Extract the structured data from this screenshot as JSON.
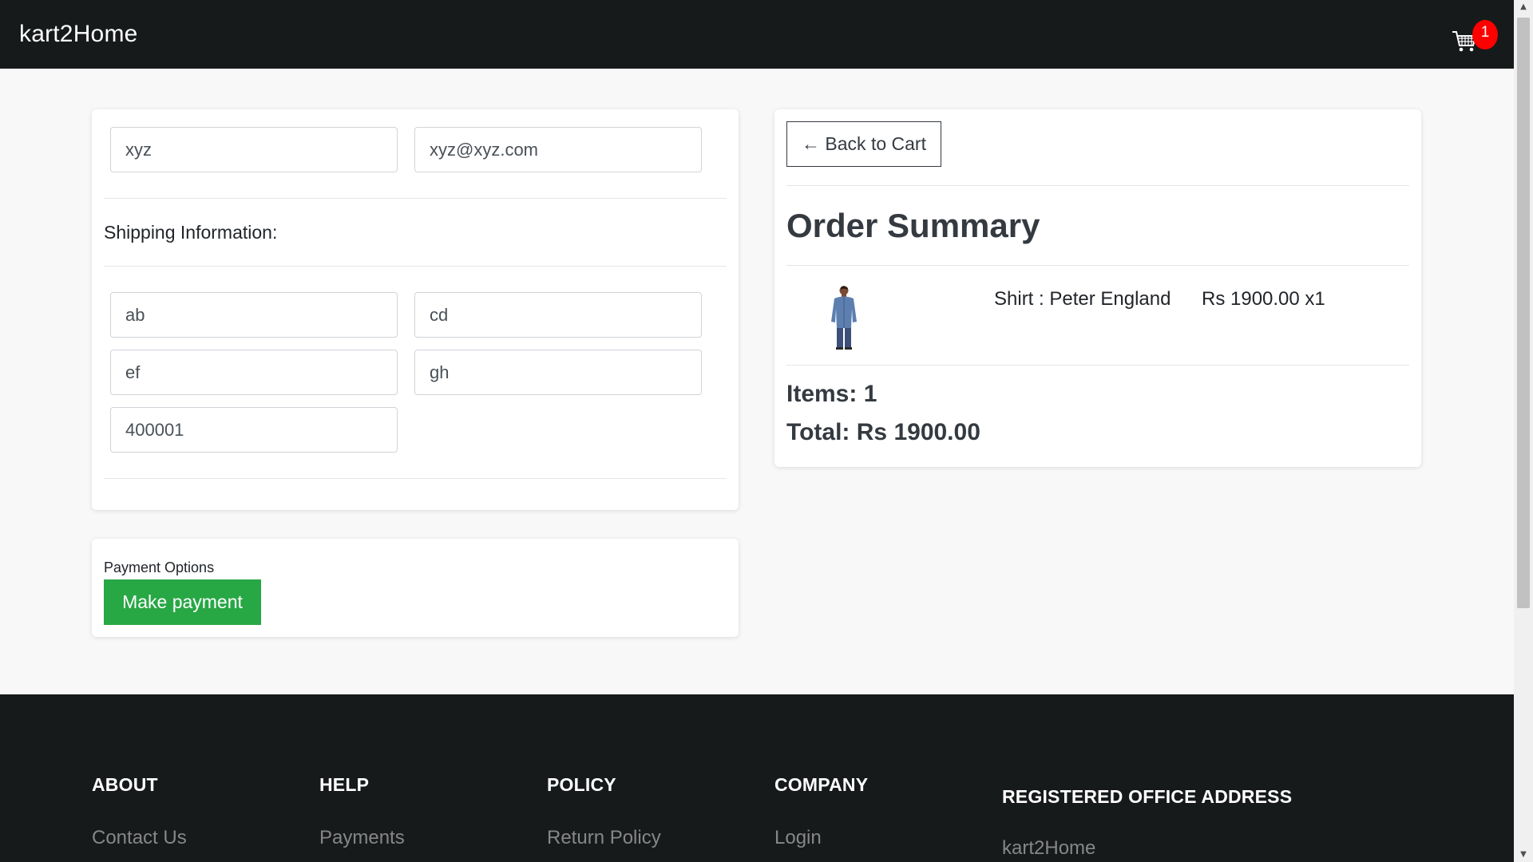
{
  "navbar": {
    "brand": "kart2Home",
    "cart_count": "1",
    "bg_color": "#171a1b"
  },
  "customer": {
    "name_value": "xyz",
    "email_value": "xyz@xyz.com"
  },
  "shipping": {
    "heading": "Shipping Information:",
    "address_value": "ab",
    "city_value": "cd",
    "state_value": "ef",
    "country_value": "gh",
    "zip_value": "400001"
  },
  "payment": {
    "label": "Payment Options",
    "button_label": "Make payment",
    "button_color": "#28a745"
  },
  "summary": {
    "back_label": "← Back to Cart",
    "title": "Order Summary",
    "items": [
      {
        "name": "Shirt : Peter England",
        "price": "Rs 1900.00 x1",
        "image": "shirt-product-image"
      }
    ],
    "items_label": "Items: 1",
    "total_label": "Total: Rs 1900.00"
  },
  "footer": {
    "columns": [
      {
        "heading": "ABOUT",
        "link": "Contact Us"
      },
      {
        "heading": "HELP",
        "link": "Payments"
      },
      {
        "heading": "POLICY",
        "link": "Return Policy"
      },
      {
        "heading": "COMPANY",
        "link": "Login"
      },
      {
        "heading": "REGISTERED OFFICE ADDRESS",
        "link": "kart2Home"
      }
    ]
  },
  "colors": {
    "badge": "#ff0000",
    "page_bg": "#f8f8f8"
  }
}
